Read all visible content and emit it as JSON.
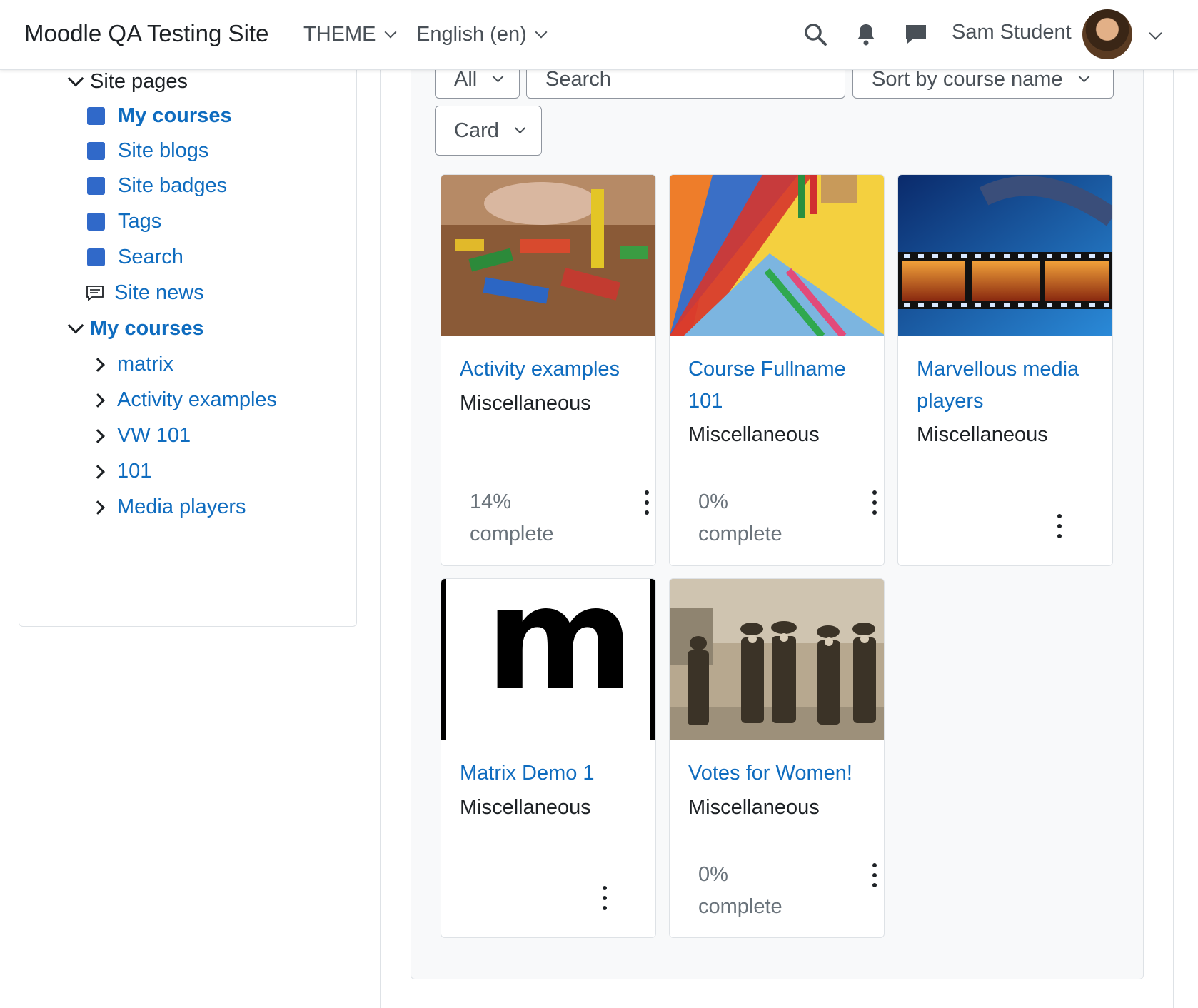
{
  "navbar": {
    "site_name": "Moodle QA Testing Site",
    "theme_label": "THEME",
    "language_label": "English (en)",
    "user_name": "Sam Student"
  },
  "drawer": {
    "site_pages_label": "Site pages",
    "site_pages": [
      {
        "label": "My courses"
      },
      {
        "label": "Site blogs"
      },
      {
        "label": "Site badges"
      },
      {
        "label": "Tags"
      },
      {
        "label": "Search"
      },
      {
        "label": "Site news"
      }
    ],
    "my_courses_label": "My courses",
    "courses": [
      {
        "label": "matrix"
      },
      {
        "label": "Activity examples"
      },
      {
        "label": "VW 101"
      },
      {
        "label": "101"
      },
      {
        "label": "Media players"
      }
    ]
  },
  "filters": {
    "grouping": "All",
    "search_placeholder": "Search",
    "sort": "Sort by course name",
    "view": "Card"
  },
  "cards": [
    {
      "title": "Activity examples",
      "category": "Miscellaneous",
      "progress_line1": "14%",
      "progress_line2": "complete",
      "progress": 14
    },
    {
      "title_line1": "Course Fullname",
      "title_line2": "101",
      "category": "Miscellaneous",
      "progress_line1": "0%",
      "progress_line2": "complete",
      "progress": 0
    },
    {
      "title_line1": "Marvellous media",
      "title_line2": "players",
      "category": "Miscellaneous"
    },
    {
      "title": "Matrix Demo 1",
      "category": "Miscellaneous",
      "image_letter": "m"
    },
    {
      "title": "Votes for Women!",
      "category": "Miscellaneous",
      "progress_line1": "0%",
      "progress_line2": "complete",
      "progress": 0
    }
  ],
  "colors": {
    "link": "#0f6cbf",
    "tree_square": "#3069c9"
  }
}
